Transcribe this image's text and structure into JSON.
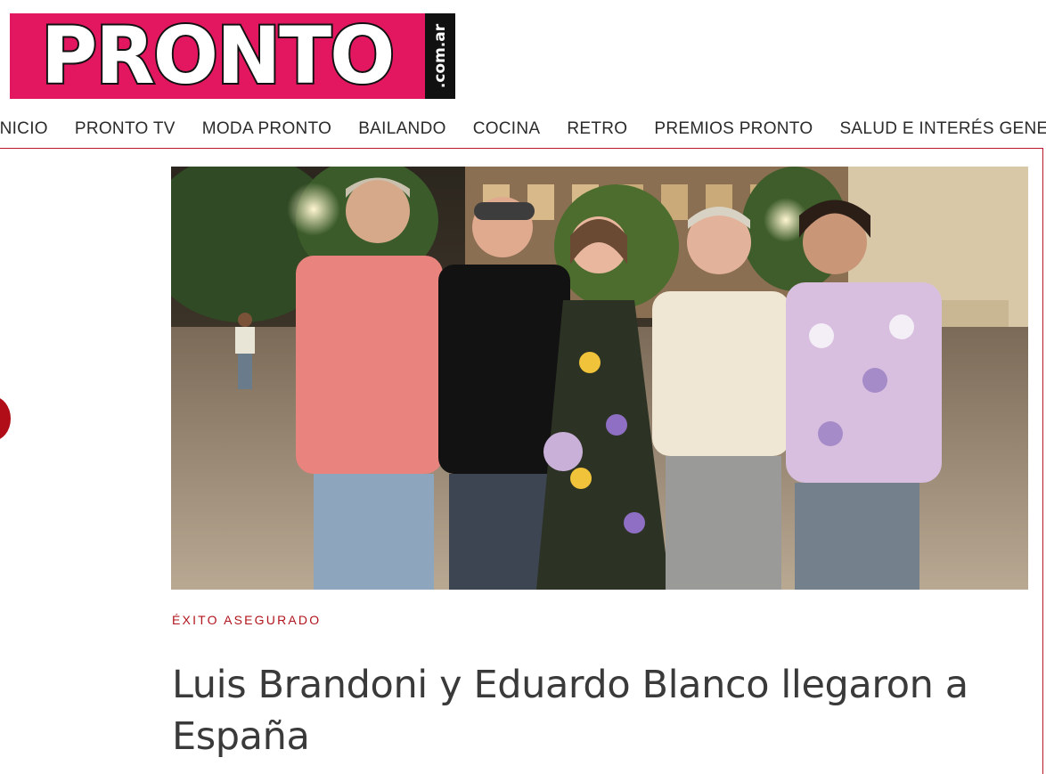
{
  "logo": {
    "wordmark": "PRONTO",
    "tld": ".com.ar",
    "brand_color": "#e3175f"
  },
  "nav": {
    "items": [
      {
        "label": "INICIO"
      },
      {
        "label": "PRONTO TV"
      },
      {
        "label": "MODA PRONTO"
      },
      {
        "label": "BAILANDO"
      },
      {
        "label": "COCINA"
      },
      {
        "label": "RETRO"
      },
      {
        "label": "PREMIOS PRONTO"
      },
      {
        "label": "SALUD E INTERÉS GENERAL"
      }
    ]
  },
  "article": {
    "kicker": "ÉXITO ASEGURADO",
    "kicker_color": "#b1141c",
    "headline": "Luis Brandoni y Eduardo Blanco llegaron a España"
  },
  "accent_color": "#b9162a"
}
